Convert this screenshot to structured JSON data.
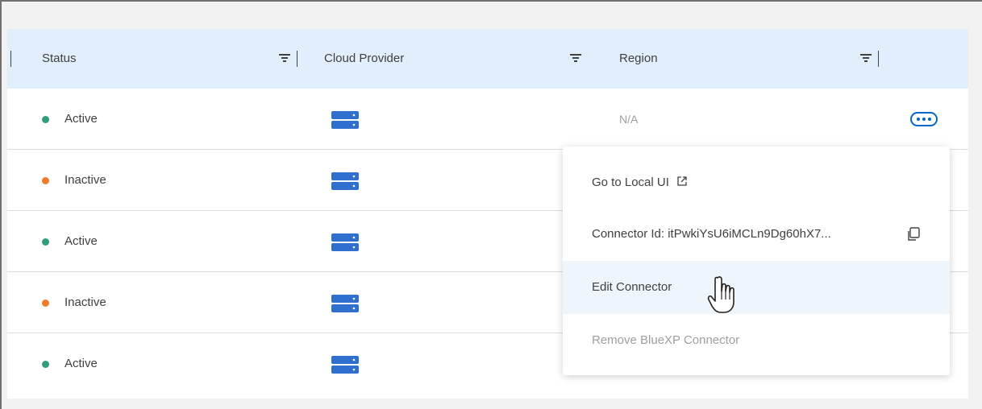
{
  "table": {
    "headers": {
      "status": "Status",
      "cloud_provider": "Cloud Provider",
      "region": "Region"
    },
    "rows": [
      {
        "status": "Active",
        "status_color": "#2e9e7c",
        "region": "N/A"
      },
      {
        "status": "Inactive",
        "status_color": "#ef7b2a",
        "region": ""
      },
      {
        "status": "Active",
        "status_color": "#2e9e7c",
        "region": ""
      },
      {
        "status": "Inactive",
        "status_color": "#ef7b2a",
        "region": ""
      },
      {
        "status": "Active",
        "status_color": "#2e9e7c",
        "region": ""
      }
    ]
  },
  "menu": {
    "go_to_local_ui": "Go to Local UI",
    "connector_id": "Connector Id: itPwkiYsU6iMCLn9Dg60hX7...",
    "edit_connector": "Edit Connector",
    "remove_connector": "Remove BlueXP Connector"
  },
  "icons": {
    "cloud_provider": "server-icon",
    "filter": "filter-icon",
    "more": "more-options-icon",
    "external": "external-link-icon",
    "copy": "copy-icon",
    "cursor": "hand-pointer-cursor"
  },
  "colors": {
    "accent": "#0067c5",
    "header_bg": "#e0effb",
    "active": "#2e9e7c",
    "inactive": "#ef7b2a"
  }
}
